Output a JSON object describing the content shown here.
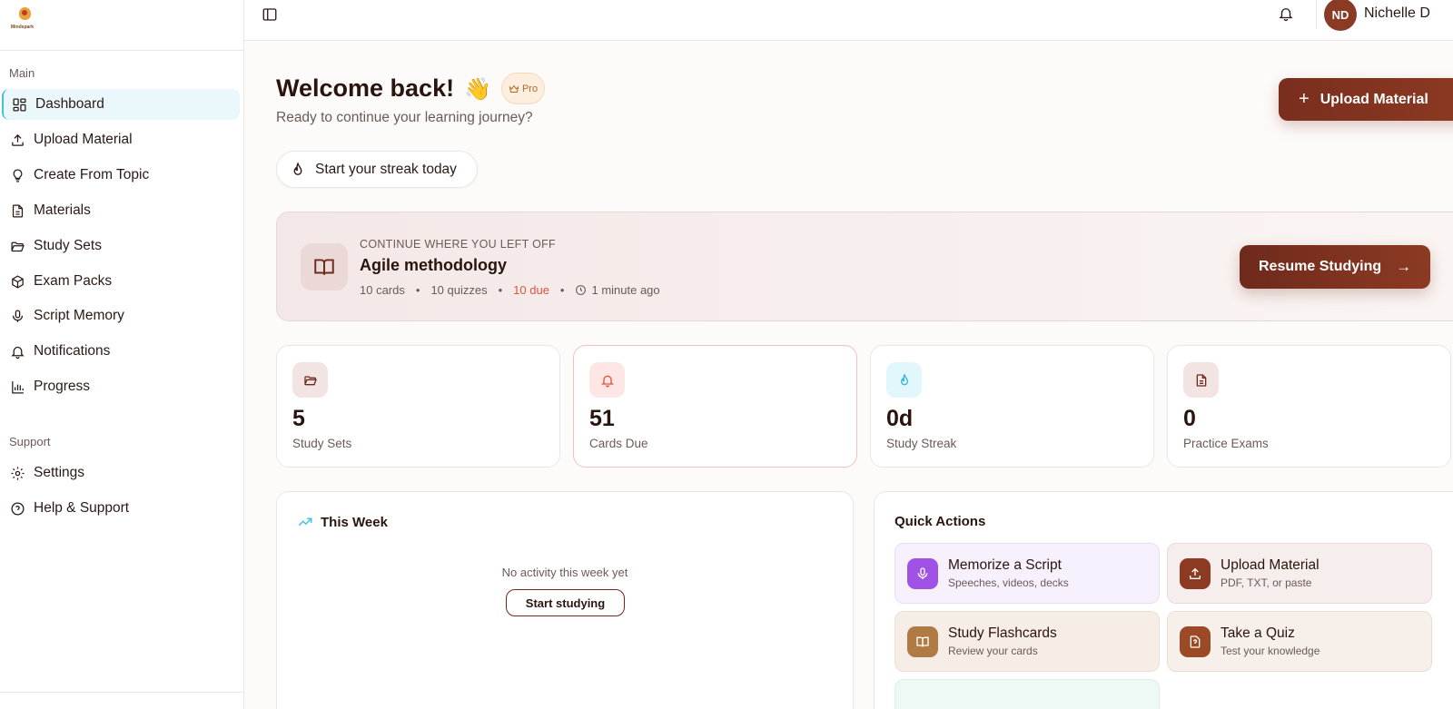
{
  "brand": {
    "logo_text": "Mindspark"
  },
  "sidebar": {
    "main_heading": "Main",
    "items": [
      {
        "label": "Dashboard",
        "icon": "dashboard-icon"
      },
      {
        "label": "Upload Material",
        "icon": "upload-icon"
      },
      {
        "label": "Create From Topic",
        "icon": "lightbulb-icon"
      },
      {
        "label": "Materials",
        "icon": "document-icon"
      },
      {
        "label": "Study Sets",
        "icon": "folder-icon"
      },
      {
        "label": "Exam Packs",
        "icon": "package-icon"
      },
      {
        "label": "Script Memory",
        "icon": "microphone-icon"
      },
      {
        "label": "Notifications",
        "icon": "bell-icon"
      },
      {
        "label": "Progress",
        "icon": "bar-chart-icon"
      }
    ],
    "support_heading": "Support",
    "support_items": [
      {
        "label": "Settings",
        "icon": "gear-icon"
      },
      {
        "label": "Help & Support",
        "icon": "help-icon"
      }
    ]
  },
  "topbar": {
    "avatar_initials": "ND",
    "user_name": "Nichelle D"
  },
  "header": {
    "welcome": "Welcome back!",
    "wave_emoji": "👋",
    "pro_badge": "Pro",
    "subtitle": "Ready to continue your learning journey?",
    "upload_button": "Upload Material",
    "streak_pill": "Start your streak today"
  },
  "continue": {
    "label": "CONTINUE WHERE YOU LEFT OFF",
    "title": "Agile methodology",
    "cards": "10 cards",
    "quizzes": "10 quizzes",
    "due": "10 due",
    "time": "1 minute ago",
    "separator": "•",
    "resume_button": "Resume Studying"
  },
  "stats": [
    {
      "value": "5",
      "label": "Study Sets",
      "icon": "folder-icon"
    },
    {
      "value": "51",
      "label": "Cards Due",
      "icon": "bell-icon"
    },
    {
      "value": "0d",
      "label": "Study Streak",
      "icon": "flame-icon"
    },
    {
      "value": "0",
      "label": "Practice Exams",
      "icon": "document-icon"
    }
  ],
  "week": {
    "title": "This Week",
    "empty_text": "No activity this week yet",
    "start_button": "Start studying"
  },
  "quick_actions": {
    "title": "Quick Actions",
    "items": [
      {
        "name": "Memorize a Script",
        "desc": "Speeches, videos, decks",
        "icon": "microphone-icon"
      },
      {
        "name": "Upload Material",
        "desc": "PDF, TXT, or paste",
        "icon": "upload-icon"
      },
      {
        "name": "Study Flashcards",
        "desc": "Review your cards",
        "icon": "book-icon"
      },
      {
        "name": "Take a Quiz",
        "desc": "Test your knowledge",
        "icon": "quiz-icon"
      }
    ]
  },
  "colors": {
    "accent": "#7a2e1e",
    "active_nav": "#eaf8fc",
    "due_red": "#e0533f",
    "purple": "#a052e6"
  }
}
